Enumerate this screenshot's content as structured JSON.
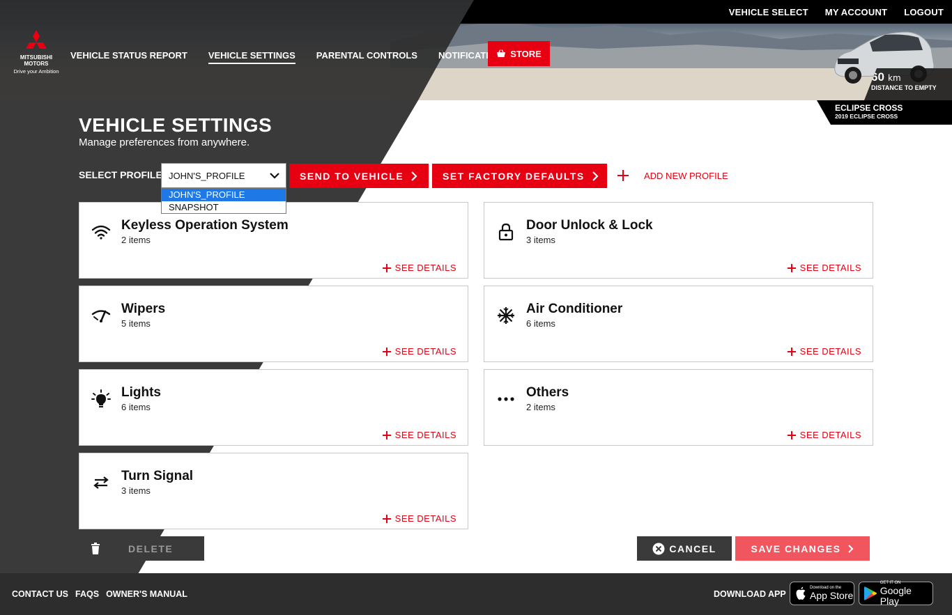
{
  "header": {
    "logo": {
      "brand_line1": "MITSUBISHI",
      "brand_line2": "MOTORS",
      "tagline": "Drive your Ambition"
    },
    "top_links": [
      "VEHICLE SELECT",
      "MY ACCOUNT",
      "LOGOUT"
    ],
    "nav": [
      {
        "label": "VEHICLE STATUS REPORT",
        "active": false
      },
      {
        "label": "VEHICLE SETTINGS",
        "active": true
      },
      {
        "label": "PARENTAL CONTROLS",
        "active": false
      },
      {
        "label": "NOTIFICATIONS",
        "active": false
      }
    ],
    "store_label": "STORE",
    "range": {
      "value": "60",
      "unit": "km",
      "label": "DISTANCE TO EMPTY"
    },
    "vehicle": {
      "model": "ECLIPSE CROSS",
      "sub": "2019 ECLIPSE CROSS"
    }
  },
  "page": {
    "title": "VEHICLE SETTINGS",
    "subtitle": "Manage preferences from anywhere."
  },
  "profile": {
    "label": "SELECT PROFILE",
    "selected": "JOHN'S_PROFILE",
    "options": [
      "JOHN'S_PROFILE",
      "SNAPSHOT"
    ],
    "send_label": "SEND TO VEHICLE",
    "factory_label": "SET FACTORY DEFAULTS",
    "add_label": "ADD NEW PROFILE"
  },
  "cards": [
    {
      "title": "Keyless Operation System",
      "count": "2 items",
      "icon": "wifi-icon",
      "details": "SEE DETAILS"
    },
    {
      "title": "Door Unlock & Lock",
      "count": "3 items",
      "icon": "lock-icon",
      "details": "SEE DETAILS"
    },
    {
      "title": "Wipers",
      "count": "5 items",
      "icon": "wiper-icon",
      "details": "SEE DETAILS"
    },
    {
      "title": "Air Conditioner",
      "count": "6 items",
      "icon": "snowflake-icon",
      "details": "SEE DETAILS"
    },
    {
      "title": "Lights",
      "count": "6 items",
      "icon": "light-bulb-icon",
      "details": "SEE DETAILS"
    },
    {
      "title": "Others",
      "count": "2 items",
      "icon": "more-dots-icon",
      "details": "SEE DETAILS"
    },
    {
      "title": "Turn Signal",
      "count": "3 items",
      "icon": "turn-signal-icon",
      "details": "SEE DETAILS"
    }
  ],
  "actions": {
    "delete": "DELETE",
    "cancel": "CANCEL",
    "save": "SAVE CHANGES"
  },
  "footer": {
    "links": [
      "CONTACT US",
      "FAQS",
      "OWNER'S MANUAL"
    ],
    "download_label": "DOWNLOAD APP",
    "appstore": {
      "small": "Download on the",
      "big": "App Store"
    },
    "googleplay": {
      "small": "GET IT ON",
      "big": "Google Play"
    }
  },
  "colors": {
    "accent": "#e60012",
    "dark": "#3a3a3a",
    "save_disabled": "#f1555e",
    "select_highlight": "#1e78e6"
  }
}
